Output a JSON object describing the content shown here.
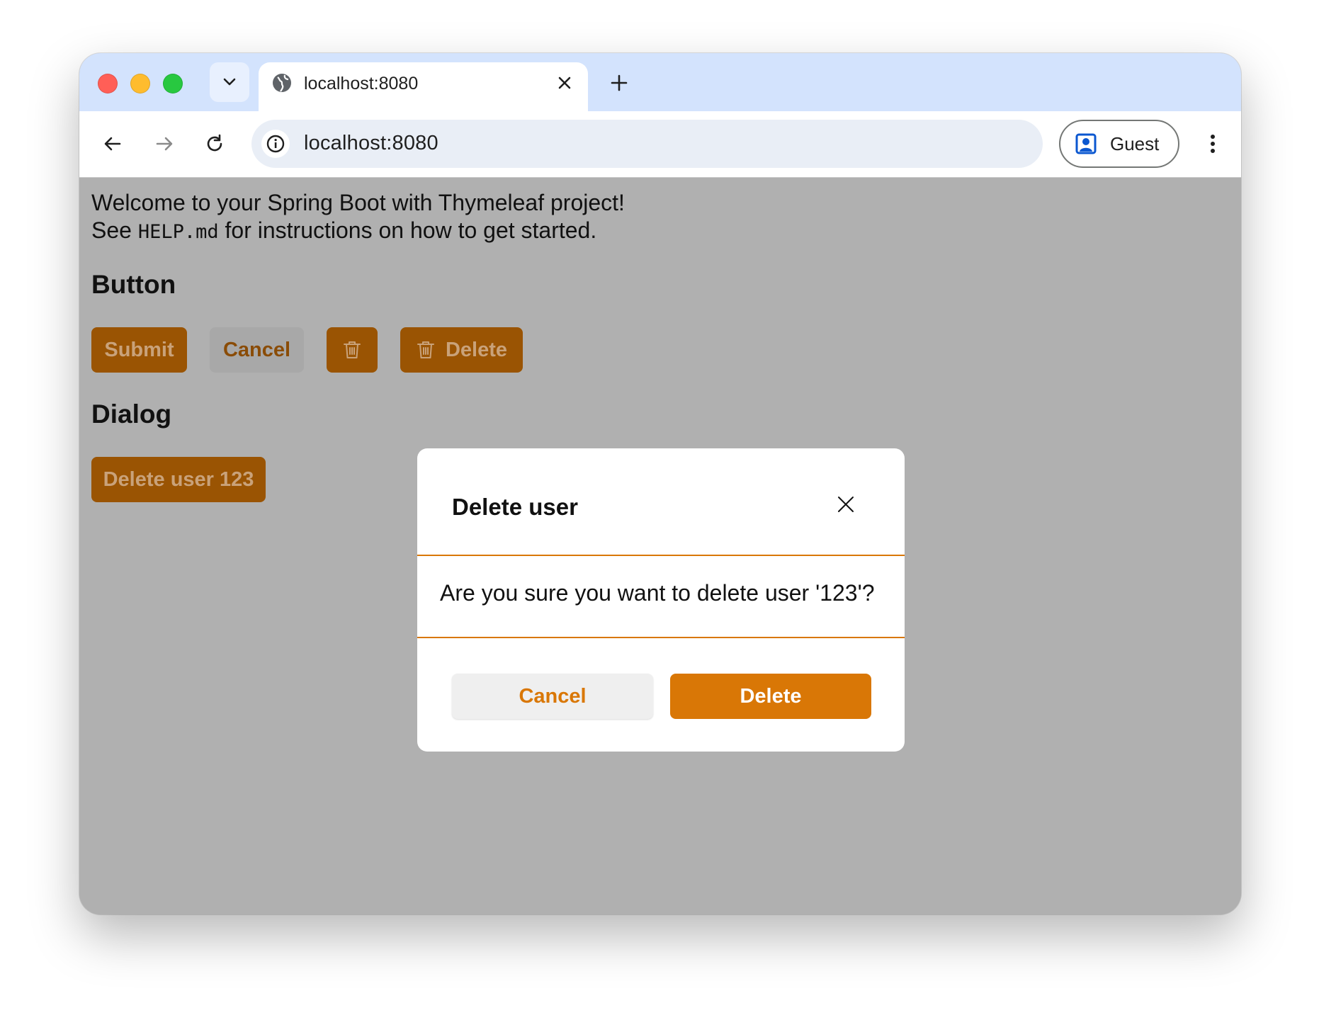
{
  "browser": {
    "tab_title": "localhost:8080",
    "url": "localhost:8080",
    "profile_label": "Guest"
  },
  "page": {
    "intro_line1": "Welcome to your Spring Boot with Thymeleaf project!",
    "intro_line2_prefix": "See ",
    "intro_line2_code": "HELP.md",
    "intro_line2_suffix": " for instructions on how to get started.",
    "button_section_heading": "Button",
    "buttons": {
      "submit": "Submit",
      "cancel": "Cancel",
      "delete_with_icon": "Delete"
    },
    "dialog_section_heading": "Dialog",
    "open_dialog_button": "Delete user 123"
  },
  "dialog": {
    "title": "Delete user",
    "message": "Are you sure you want to delete user '123'?",
    "cancel_label": "Cancel",
    "confirm_label": "Delete"
  },
  "colors": {
    "accent": "#d97706",
    "overlay": "#b0b0b0",
    "tabbar": "#d3e3fd"
  }
}
